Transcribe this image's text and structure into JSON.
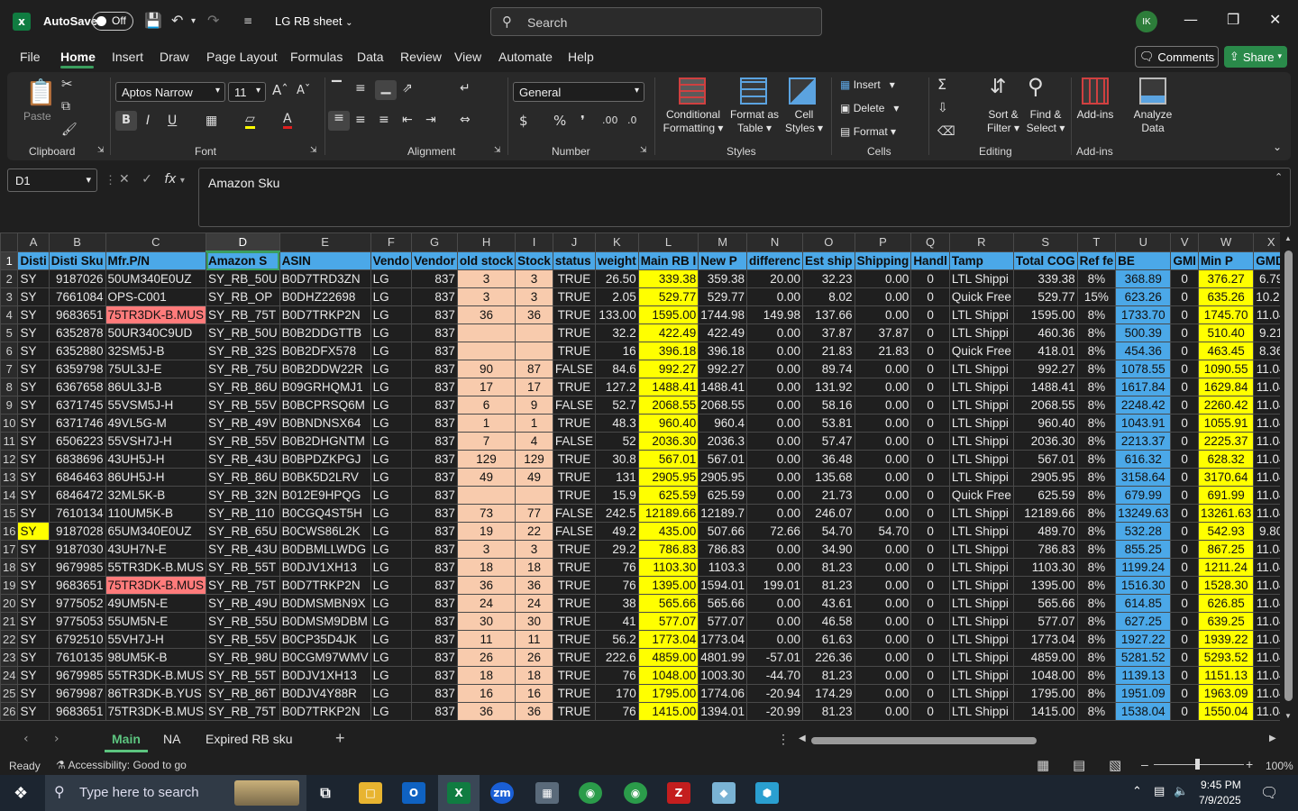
{
  "title": {
    "autosave": "AutoSave",
    "autosave_state": "Off",
    "doc": "LG RB sheet",
    "search_placeholder": "Search",
    "avatar": "IK"
  },
  "menu": [
    "File",
    "Home",
    "Insert",
    "Draw",
    "Page Layout",
    "Formulas",
    "Data",
    "Review",
    "View",
    "Automate",
    "Help"
  ],
  "menu_active": "Home",
  "actions": {
    "comments": "Comments",
    "share": "Share"
  },
  "ribbon": {
    "paste": "Paste",
    "clipboard": "Clipboard",
    "font_name": "Aptos Narrow",
    "font_size": "11",
    "font": "Font",
    "alignment": "Alignment",
    "number_format": "General",
    "number": "Number",
    "cond_format_1": "Conditional",
    "cond_format_2": "Formatting",
    "format_table_1": "Format as",
    "format_table_2": "Table",
    "cell_styles_1": "Cell",
    "cell_styles_2": "Styles",
    "styles": "Styles",
    "insert": "Insert",
    "delete": "Delete",
    "format": "Format",
    "cells": "Cells",
    "sort_1": "Sort &",
    "sort_2": "Filter",
    "find_1": "Find &",
    "find_2": "Select",
    "editing": "Editing",
    "addins": "Add-ins",
    "addins_grp": "Add-ins",
    "analyze_1": "Analyze",
    "analyze_2": "Data"
  },
  "formula_bar": {
    "name_box": "D1",
    "content": "Amazon Sku"
  },
  "columns": [
    "A",
    "B",
    "C",
    "D",
    "E",
    "F",
    "G",
    "H",
    "I",
    "J",
    "K",
    "L",
    "M",
    "N",
    "O",
    "P",
    "Q",
    "R",
    "S",
    "T",
    "U",
    "V",
    "W",
    "X"
  ],
  "selected_column": "D",
  "headers": [
    "Disti",
    "Disti Sku",
    "Mfr.P/N",
    "Amazon S",
    "ASIN",
    "Vendo",
    "Vendor",
    "old stock",
    "Stock",
    "status",
    "weight",
    "Main RB I",
    "New P",
    "differenc",
    "Est ship",
    "Shipping",
    "Handl",
    "Tamp",
    "Total COG",
    "Ref fe",
    "BE",
    "GMI",
    "Min P",
    "GMD"
  ],
  "rows": [
    [
      "SY",
      "9187026",
      "50UM340E0UZ",
      "SY_RB_50U",
      "B0D7TRD3ZN",
      "LG",
      "837",
      "3",
      "3",
      "TRUE",
      "26.50",
      "339.38",
      "359.38",
      "20.00",
      "32.23",
      "0.00",
      "0",
      "LTL Shippi",
      "339.38",
      "8%",
      "368.89",
      "0",
      "376.27",
      "6.79"
    ],
    [
      "SY",
      "7661084",
      "OPS-C001",
      "SY_RB_OP",
      "B0DHZ22698",
      "LG",
      "837",
      "3",
      "3",
      "TRUE",
      "2.05",
      "529.77",
      "529.77",
      "0.00",
      "8.02",
      "0.00",
      "0",
      "Quick Free",
      "529.77",
      "15%",
      "623.26",
      "0",
      "635.26",
      "10.20"
    ],
    [
      "SY",
      "9683651",
      "75TR3DK-B.MUS",
      "SY_RB_75T",
      "B0D7TRKP2N",
      "LG",
      "837",
      "36",
      "36",
      "TRUE",
      "133.00",
      "1595.00",
      "1744.98",
      "149.98",
      "137.66",
      "0.00",
      "0",
      "LTL Shippi",
      "1595.00",
      "8%",
      "1733.70",
      "0",
      "1745.70",
      "11.04"
    ],
    [
      "SY",
      "6352878",
      "50UR340C9UD",
      "SY_RB_50U",
      "B0B2DDGTTB",
      "LG",
      "837",
      "",
      "",
      "TRUE",
      "32.2",
      "422.49",
      "422.49",
      "0.00",
      "37.87",
      "37.87",
      "0",
      "LTL Shippi",
      "460.36",
      "8%",
      "500.39",
      "0",
      "510.40",
      "9.21"
    ],
    [
      "SY",
      "6352880",
      "32SM5J-B",
      "SY_RB_32S",
      "B0B2DFX578",
      "LG",
      "837",
      "",
      "",
      "TRUE",
      "16",
      "396.18",
      "396.18",
      "0.00",
      "21.83",
      "21.83",
      "0",
      "Quick Free",
      "418.01",
      "8%",
      "454.36",
      "0",
      "463.45",
      "8.36"
    ],
    [
      "SY",
      "6359798",
      "75UL3J-E",
      "SY_RB_75U",
      "B0B2DDW22R",
      "LG",
      "837",
      "90",
      "87",
      "FALSE",
      "84.6",
      "992.27",
      "992.27",
      "0.00",
      "89.74",
      "0.00",
      "0",
      "LTL Shippi",
      "992.27",
      "8%",
      "1078.55",
      "0",
      "1090.55",
      "11.04"
    ],
    [
      "SY",
      "6367658",
      "86UL3J-B",
      "SY_RB_86U",
      "B09GRHQMJ1",
      "LG",
      "837",
      "17",
      "17",
      "TRUE",
      "127.2",
      "1488.41",
      "1488.41",
      "0.00",
      "131.92",
      "0.00",
      "0",
      "LTL Shippi",
      "1488.41",
      "8%",
      "1617.84",
      "0",
      "1629.84",
      "11.04"
    ],
    [
      "SY",
      "6371745",
      "55VSM5J-H",
      "SY_RB_55V",
      "B0BCPRSQ6M",
      "LG",
      "837",
      "6",
      "9",
      "FALSE",
      "52.7",
      "2068.55",
      "2068.55",
      "0.00",
      "58.16",
      "0.00",
      "0",
      "LTL Shippi",
      "2068.55",
      "8%",
      "2248.42",
      "0",
      "2260.42",
      "11.04"
    ],
    [
      "SY",
      "6371746",
      "49VL5G-M",
      "SY_RB_49V",
      "B0BNDNSX64",
      "LG",
      "837",
      "1",
      "1",
      "TRUE",
      "48.3",
      "960.40",
      "960.4",
      "0.00",
      "53.81",
      "0.00",
      "0",
      "LTL Shippi",
      "960.40",
      "8%",
      "1043.91",
      "0",
      "1055.91",
      "11.04"
    ],
    [
      "SY",
      "6506223",
      "55VSH7J-H",
      "SY_RB_55V",
      "B0B2DHGNTM",
      "LG",
      "837",
      "7",
      "4",
      "FALSE",
      "52",
      "2036.30",
      "2036.3",
      "0.00",
      "57.47",
      "0.00",
      "0",
      "LTL Shippi",
      "2036.30",
      "8%",
      "2213.37",
      "0",
      "2225.37",
      "11.04"
    ],
    [
      "SY",
      "6838696",
      "43UH5J-H",
      "SY_RB_43U",
      "B0BPDZKPGJ",
      "LG",
      "837",
      "129",
      "129",
      "TRUE",
      "30.8",
      "567.01",
      "567.01",
      "0.00",
      "36.48",
      "0.00",
      "0",
      "LTL Shippi",
      "567.01",
      "8%",
      "616.32",
      "0",
      "628.32",
      "11.04"
    ],
    [
      "SY",
      "6846463",
      "86UH5J-H",
      "SY_RB_86U",
      "B0BK5D2LRV",
      "LG",
      "837",
      "49",
      "49",
      "TRUE",
      "131",
      "2905.95",
      "2905.95",
      "0.00",
      "135.68",
      "0.00",
      "0",
      "LTL Shippi",
      "2905.95",
      "8%",
      "3158.64",
      "0",
      "3170.64",
      "11.04"
    ],
    [
      "SY",
      "6846472",
      "32ML5K-B",
      "SY_RB_32N",
      "B012E9HPQG",
      "LG",
      "837",
      "",
      "",
      "TRUE",
      "15.9",
      "625.59",
      "625.59",
      "0.00",
      "21.73",
      "0.00",
      "0",
      "Quick Free",
      "625.59",
      "8%",
      "679.99",
      "0",
      "691.99",
      "11.04"
    ],
    [
      "SY",
      "7610134",
      "110UM5K-B",
      "SY_RB_110",
      "B0CGQ4ST5H",
      "LG",
      "837",
      "73",
      "77",
      "FALSE",
      "242.5",
      "12189.66",
      "12189.7",
      "0.00",
      "246.07",
      "0.00",
      "0",
      "LTL Shippi",
      "12189.66",
      "8%",
      "13249.63",
      "0",
      "13261.63",
      "11.04"
    ],
    [
      "SY",
      "9187028",
      "65UM340E0UZ",
      "SY_RB_65U",
      "B0CWS86L2K",
      "LG",
      "837",
      "19",
      "22",
      "FALSE",
      "49.2",
      "435.00",
      "507.66",
      "72.66",
      "54.70",
      "54.70",
      "0",
      "LTL Shippi",
      "489.70",
      "8%",
      "532.28",
      "0",
      "542.93",
      "9.80"
    ],
    [
      "SY",
      "9187030",
      "43UH7N-E",
      "SY_RB_43U",
      "B0DBMLLWDG",
      "LG",
      "837",
      "3",
      "3",
      "TRUE",
      "29.2",
      "786.83",
      "786.83",
      "0.00",
      "34.90",
      "0.00",
      "0",
      "LTL Shippi",
      "786.83",
      "8%",
      "855.25",
      "0",
      "867.25",
      "11.04"
    ],
    [
      "SY",
      "9679985",
      "55TR3DK-B.MUS",
      "SY_RB_55T",
      "B0DJV1XH13",
      "LG",
      "837",
      "18",
      "18",
      "TRUE",
      "76",
      "1103.30",
      "1103.3",
      "0.00",
      "81.23",
      "0.00",
      "0",
      "LTL Shippi",
      "1103.30",
      "8%",
      "1199.24",
      "0",
      "1211.24",
      "11.04"
    ],
    [
      "SY",
      "9683651",
      "75TR3DK-B.MUS",
      "SY_RB_75T",
      "B0D7TRKP2N",
      "LG",
      "837",
      "36",
      "36",
      "TRUE",
      "76",
      "1395.00",
      "1594.01",
      "199.01",
      "81.23",
      "0.00",
      "0",
      "LTL Shippi",
      "1395.00",
      "8%",
      "1516.30",
      "0",
      "1528.30",
      "11.04"
    ],
    [
      "SY",
      "9775052",
      "49UM5N-E",
      "SY_RB_49U",
      "B0DMSMBN9X",
      "LG",
      "837",
      "24",
      "24",
      "TRUE",
      "38",
      "565.66",
      "565.66",
      "0.00",
      "43.61",
      "0.00",
      "0",
      "LTL Shippi",
      "565.66",
      "8%",
      "614.85",
      "0",
      "626.85",
      "11.04"
    ],
    [
      "SY",
      "9775053",
      "55UM5N-E",
      "SY_RB_55U",
      "B0DMSM9DBM",
      "LG",
      "837",
      "30",
      "30",
      "TRUE",
      "41",
      "577.07",
      "577.07",
      "0.00",
      "46.58",
      "0.00",
      "0",
      "LTL Shippi",
      "577.07",
      "8%",
      "627.25",
      "0",
      "639.25",
      "11.04"
    ],
    [
      "SY",
      "6792510",
      "55VH7J-H",
      "SY_RB_55V",
      "B0CP35D4JK",
      "LG",
      "837",
      "11",
      "11",
      "TRUE",
      "56.2",
      "1773.04",
      "1773.04",
      "0.00",
      "61.63",
      "0.00",
      "0",
      "LTL Shippi",
      "1773.04",
      "8%",
      "1927.22",
      "0",
      "1939.22",
      "11.04"
    ],
    [
      "SY",
      "7610135",
      "98UM5K-B",
      "SY_RB_98U",
      "B0CGM97WMV",
      "LG",
      "837",
      "26",
      "26",
      "TRUE",
      "222.6",
      "4859.00",
      "4801.99",
      "-57.01",
      "226.36",
      "0.00",
      "0",
      "LTL Shippi",
      "4859.00",
      "8%",
      "5281.52",
      "0",
      "5293.52",
      "11.04"
    ],
    [
      "SY",
      "9679985",
      "55TR3DK-B.MUS",
      "SY_RB_55T",
      "B0DJV1XH13",
      "LG",
      "837",
      "18",
      "18",
      "TRUE",
      "76",
      "1048.00",
      "1003.30",
      "-44.70",
      "81.23",
      "0.00",
      "0",
      "LTL Shippi",
      "1048.00",
      "8%",
      "1139.13",
      "0",
      "1151.13",
      "11.04"
    ],
    [
      "SY",
      "9679987",
      "86TR3DK-B.YUS",
      "SY_RB_86T",
      "B0DJV4Y88R",
      "LG",
      "837",
      "16",
      "16",
      "TRUE",
      "170",
      "1795.00",
      "1774.06",
      "-20.94",
      "174.29",
      "0.00",
      "0",
      "LTL Shippi",
      "1795.00",
      "8%",
      "1951.09",
      "0",
      "1963.09",
      "11.04"
    ],
    [
      "SY",
      "9683651",
      "75TR3DK-B.MUS",
      "SY_RB_75T",
      "B0D7TRKP2N",
      "LG",
      "837",
      "36",
      "36",
      "TRUE",
      "76",
      "1415.00",
      "1394.01",
      "-20.99",
      "81.23",
      "0.00",
      "0",
      "LTL Shippi",
      "1415.00",
      "8%",
      "1538.04",
      "0",
      "1550.04",
      "11.04"
    ]
  ],
  "highlight": {
    "pink_c_rows": [
      4,
      19
    ],
    "yellow_a_rows": [
      16
    ]
  },
  "sheet_tabs": [
    "Main",
    "NA",
    "Expired RB sku"
  ],
  "active_tab": "Main",
  "status": {
    "ready": "Ready",
    "accessibility": "Accessibility: Good to go",
    "zoom": "100%"
  },
  "taskbar": {
    "search_placeholder": "Type here to search",
    "time": "9:45 PM",
    "date": "7/9/2025"
  },
  "colors": {
    "accent": "#3b9e5e",
    "header_blue": "#4ba8e8",
    "yellow": "#ffff00",
    "orange": "#f8cbad",
    "pink": "#ff7b7b"
  }
}
